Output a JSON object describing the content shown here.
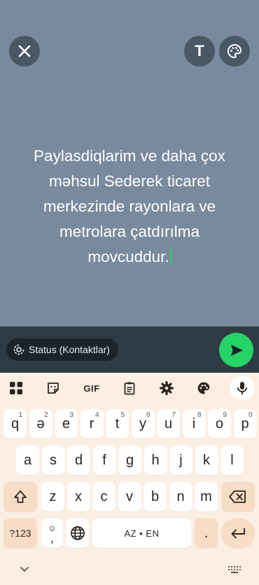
{
  "composer": {
    "text": "Paylasdiqlarim ve daha çox məhsul Sederek ticaret merkezinde rayonlara ve metrolara çatdırılma movcuddur.",
    "lines": [
      "Paylasdiqlarim ve daha çox",
      "məhsul Sederek ticaret",
      "merkezinde rayonlara ve",
      "metrolara çatdırılma",
      "movcuddur."
    ],
    "text_tool_label": "T"
  },
  "audience": {
    "label": "Status (Kontaktlar)"
  },
  "colors": {
    "canvas": "#7a8a9e",
    "send": "#25d366",
    "keyboard": "#fbeee3",
    "fn_key": "#f7dcc6"
  },
  "keyboard_toolbar": {
    "gif_label": "GIF",
    "icons": [
      "apps-grid-icon",
      "sticker-icon",
      "gif-icon",
      "clipboard-icon",
      "settings-icon",
      "palette-icon",
      "mic-icon"
    ]
  },
  "keyboard": {
    "row1": [
      {
        "k": "q",
        "h": "1"
      },
      {
        "k": "ə",
        "h": "2"
      },
      {
        "k": "e",
        "h": "3"
      },
      {
        "k": "r",
        "h": "4"
      },
      {
        "k": "t",
        "h": "5"
      },
      {
        "k": "y",
        "h": "6"
      },
      {
        "k": "u",
        "h": "7"
      },
      {
        "k": "i",
        "h": "8"
      },
      {
        "k": "o",
        "h": "9"
      },
      {
        "k": "p",
        "h": "0"
      }
    ],
    "row2": [
      "a",
      "s",
      "d",
      "f",
      "g",
      "h",
      "j",
      "k",
      "l"
    ],
    "row3": [
      "z",
      "x",
      "c",
      "v",
      "b",
      "n",
      "m"
    ],
    "symbols_label": "?123",
    "emoji_comma": ",",
    "space_label": "AZ • EN",
    "period": "."
  }
}
